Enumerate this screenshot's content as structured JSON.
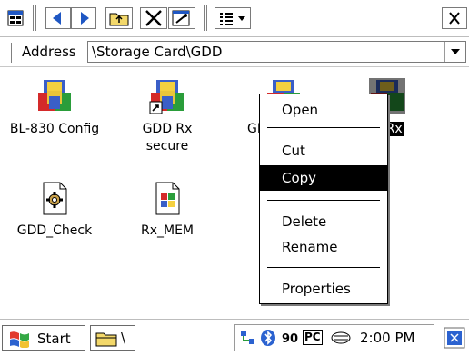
{
  "toolbar": {
    "icons": [
      "view-icon",
      "back-icon",
      "forward-icon",
      "up-folder-icon",
      "delete-icon",
      "properties-icon",
      "view-menu-icon",
      "close-icon"
    ]
  },
  "address": {
    "label": "Address",
    "value": "\\Storage Card\\GDD"
  },
  "files": [
    {
      "label": "BL-830 Config",
      "icon": "app-icon",
      "selected": false
    },
    {
      "label": "GDD Rx",
      "label2": "secure",
      "icon": "app-shortcut-icon",
      "selected": false
    },
    {
      "label": "GDD",
      "icon": "app-icon",
      "selected": false
    },
    {
      "label": "D Rx",
      "icon": "app-icon-selected",
      "selected": true
    },
    {
      "label": "GDD_Check",
      "icon": "gear-file-icon",
      "selected": false
    },
    {
      "label": "Rx_MEM",
      "icon": "windows-file-icon",
      "selected": false
    }
  ],
  "context_menu": {
    "items": [
      {
        "label": "Open"
      },
      {
        "label": "Cut"
      },
      {
        "label": "Copy",
        "highlighted": true
      },
      {
        "label": "Delete"
      },
      {
        "label": "Rename"
      },
      {
        "label": "Properties"
      }
    ]
  },
  "taskbar": {
    "start_label": "Start",
    "task_label": "\\",
    "tray_pc_label": "PC",
    "clock": "2:00 PM"
  },
  "colors": {
    "selection": "#000000",
    "menu_highlight": "#000000",
    "toolbar_blue": "#1f57c3"
  }
}
